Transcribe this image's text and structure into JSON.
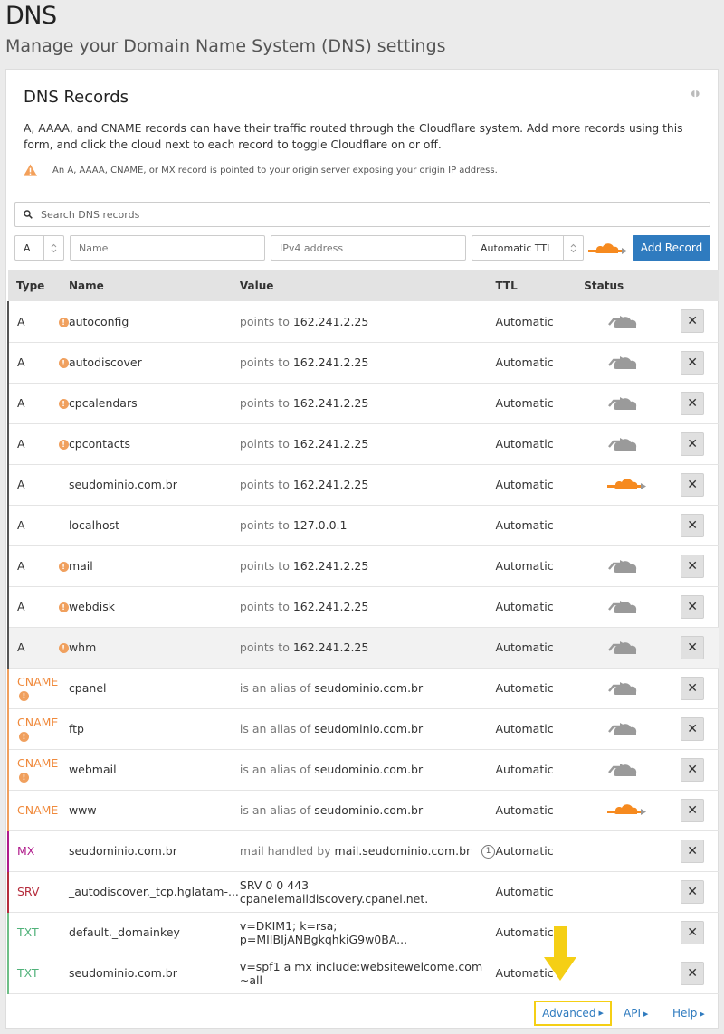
{
  "page": {
    "title": "DNS",
    "subtitle": "Manage your Domain Name System (DNS) settings"
  },
  "card": {
    "title": "DNS Records",
    "description": "A, AAAA, and CNAME records can have their traffic routed through the Cloudflare system. Add more records using this form, and click the cloud next to each record to toggle Cloudflare on or off.",
    "warning": "An A, AAAA, CNAME, or MX record is pointed to your origin server exposing your origin IP address."
  },
  "search": {
    "placeholder": "Search DNS records"
  },
  "add_form": {
    "type_value": "A",
    "name_placeholder": "Name",
    "value_placeholder": "IPv4 address",
    "ttl_value": "Automatic TTL",
    "add_label": "Add Record"
  },
  "table": {
    "headers": {
      "type": "Type",
      "name": "Name",
      "value": "Value",
      "ttl": "TTL",
      "status": "Status"
    },
    "rows": [
      {
        "type": "A",
        "warn": true,
        "name": "autoconfig",
        "prefix": "points to",
        "value": "162.241.2.25",
        "ttl": "Automatic",
        "status": "grey"
      },
      {
        "type": "A",
        "warn": true,
        "name": "autodiscover",
        "prefix": "points to",
        "value": "162.241.2.25",
        "ttl": "Automatic",
        "status": "grey"
      },
      {
        "type": "A",
        "warn": true,
        "name": "cpcalendars",
        "prefix": "points to",
        "value": "162.241.2.25",
        "ttl": "Automatic",
        "status": "grey"
      },
      {
        "type": "A",
        "warn": true,
        "name": "cpcontacts",
        "prefix": "points to",
        "value": "162.241.2.25",
        "ttl": "Automatic",
        "status": "grey"
      },
      {
        "type": "A",
        "warn": false,
        "name": "seudominio.com.br",
        "prefix": "points to",
        "value": "162.241.2.25",
        "ttl": "Automatic",
        "status": "orange"
      },
      {
        "type": "A",
        "warn": false,
        "name": "localhost",
        "prefix": "points to",
        "value": "127.0.0.1",
        "ttl": "Automatic",
        "status": "none"
      },
      {
        "type": "A",
        "warn": true,
        "name": "mail",
        "prefix": "points to",
        "value": "162.241.2.25",
        "ttl": "Automatic",
        "status": "grey"
      },
      {
        "type": "A",
        "warn": true,
        "name": "webdisk",
        "prefix": "points to",
        "value": "162.241.2.25",
        "ttl": "Automatic",
        "status": "grey"
      },
      {
        "type": "A",
        "warn": true,
        "name": "whm",
        "prefix": "points to",
        "value": "162.241.2.25",
        "ttl": "Automatic",
        "status": "grey",
        "shaded": true
      },
      {
        "type": "CNAME",
        "warn": true,
        "name": "cpanel",
        "prefix": "is an alias of",
        "value": "seudominio.com.br",
        "ttl": "Automatic",
        "status": "grey"
      },
      {
        "type": "CNAME",
        "warn": true,
        "name": "ftp",
        "prefix": "is an alias of",
        "value": "seudominio.com.br",
        "ttl": "Automatic",
        "status": "grey"
      },
      {
        "type": "CNAME",
        "warn": true,
        "name": "webmail",
        "prefix": "is an alias of",
        "value": "seudominio.com.br",
        "ttl": "Automatic",
        "status": "grey"
      },
      {
        "type": "CNAME",
        "warn": false,
        "name": "www",
        "prefix": "is an alias of",
        "value": "seudominio.com.br",
        "ttl": "Automatic",
        "status": "orange"
      },
      {
        "type": "MX",
        "warn": false,
        "name": "seudominio.com.br",
        "prefix": "mail handled by",
        "value": "mail.seudominio.com.br",
        "priority": "1",
        "ttl": "Automatic",
        "status": "none"
      },
      {
        "type": "SRV",
        "warn": false,
        "name": "_autodiscover._tcp.hglatam-...",
        "prefix": "",
        "value": "SRV 0 0 443 cpanelemaildiscovery.cpanel.net.",
        "ttl": "Automatic",
        "status": "none"
      },
      {
        "type": "TXT",
        "warn": false,
        "name": "default._domainkey",
        "prefix": "",
        "value": "v=DKIM1; k=rsa; p=MIIBIjANBgkqhkiG9w0BA...",
        "ttl": "Automatic",
        "status": "none"
      },
      {
        "type": "TXT",
        "warn": false,
        "name": "seudominio.com.br",
        "prefix": "",
        "value": "v=spf1 a mx include:websitewelcome.com ~all",
        "ttl": "Automatic",
        "status": "none"
      }
    ]
  },
  "footer": {
    "advanced": "Advanced",
    "api": "API",
    "help": "Help"
  },
  "colors": {
    "accent": "#2f7bbf",
    "orange": "#f68a1f",
    "highlight": "#f5cf15"
  }
}
